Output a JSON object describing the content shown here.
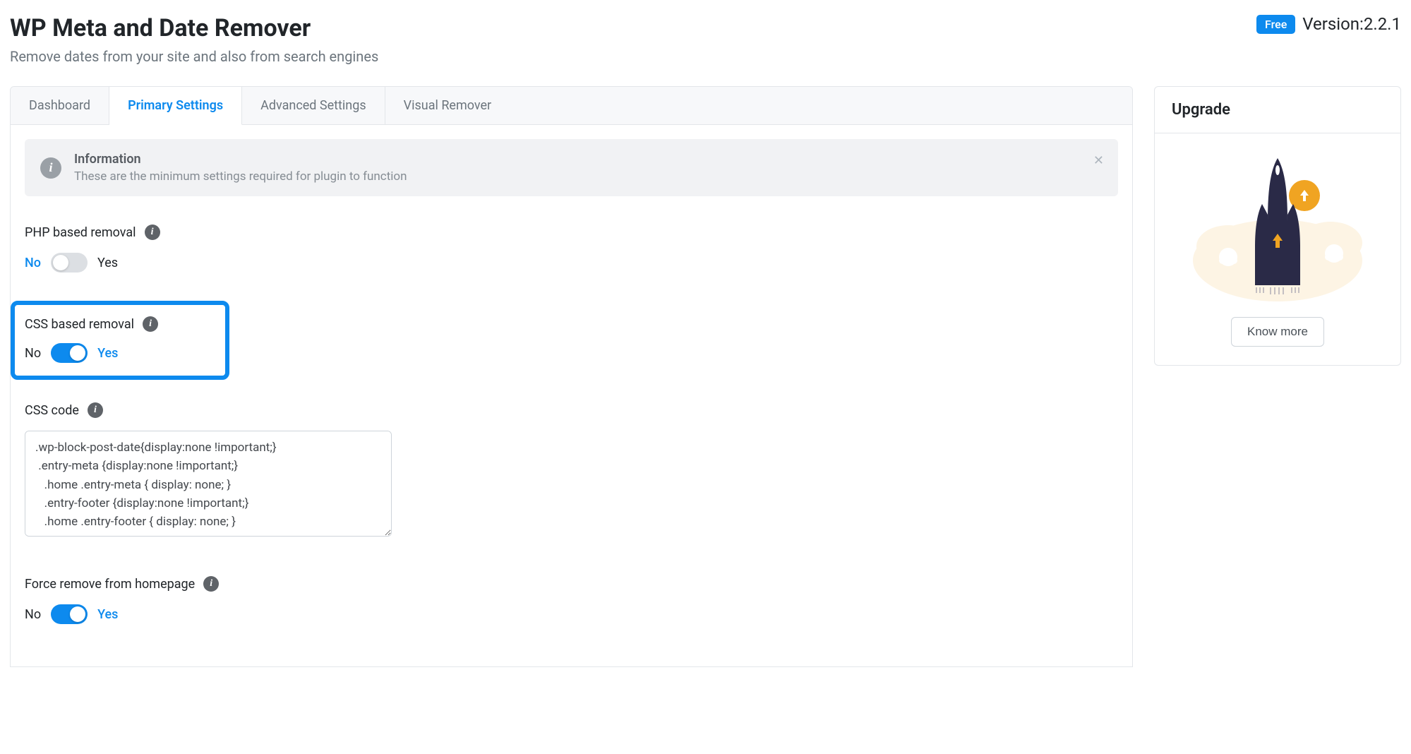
{
  "header": {
    "title": "WP Meta and Date Remover",
    "subtitle": "Remove dates from your site and also from search engines",
    "badge": "Free",
    "version_label": "Version:",
    "version": "2.2.1"
  },
  "tabs": {
    "items": [
      {
        "label": "Dashboard",
        "active": false
      },
      {
        "label": "Primary Settings",
        "active": true
      },
      {
        "label": "Advanced Settings",
        "active": false
      },
      {
        "label": "Visual Remover",
        "active": false
      }
    ]
  },
  "info": {
    "title": "Information",
    "body": "These are the minimum settings required for plugin to function"
  },
  "settings": {
    "php_removal": {
      "label": "PHP based removal",
      "no": "No",
      "yes": "Yes",
      "value": false
    },
    "css_removal": {
      "label": "CSS based removal",
      "no": "No",
      "yes": "Yes",
      "value": true
    },
    "css_code": {
      "label": "CSS code",
      "value": ".wp-block-post-date{display:none !important;}\n .entry-meta {display:none !important;}\n   .home .entry-meta { display: none; }\n   .entry-footer {display:none !important;}\n   .home .entry-footer { display: none; }"
    },
    "force_homepage": {
      "label": "Force remove from homepage",
      "no": "No",
      "yes": "Yes",
      "value": true
    }
  },
  "sidebar": {
    "title": "Upgrade",
    "button": "Know more"
  }
}
